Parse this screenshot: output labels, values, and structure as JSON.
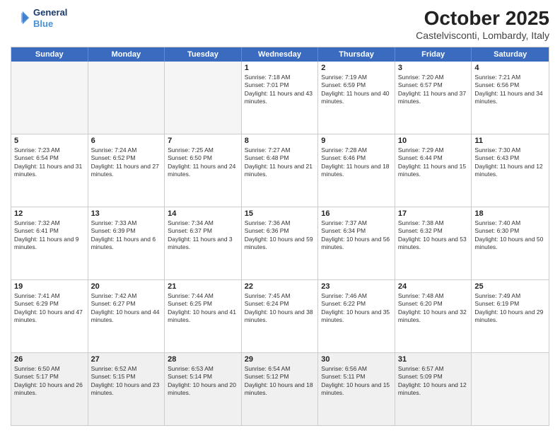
{
  "header": {
    "logo_line1": "General",
    "logo_line2": "Blue",
    "month_title": "October 2025",
    "location": "Castelvisconti, Lombardy, Italy"
  },
  "weekdays": [
    "Sunday",
    "Monday",
    "Tuesday",
    "Wednesday",
    "Thursday",
    "Friday",
    "Saturday"
  ],
  "rows": [
    [
      {
        "day": "",
        "empty": true
      },
      {
        "day": "",
        "empty": true
      },
      {
        "day": "",
        "empty": true
      },
      {
        "day": "1",
        "sunrise": "Sunrise: 7:18 AM",
        "sunset": "Sunset: 7:01 PM",
        "daylight": "Daylight: 11 hours and 43 minutes."
      },
      {
        "day": "2",
        "sunrise": "Sunrise: 7:19 AM",
        "sunset": "Sunset: 6:59 PM",
        "daylight": "Daylight: 11 hours and 40 minutes."
      },
      {
        "day": "3",
        "sunrise": "Sunrise: 7:20 AM",
        "sunset": "Sunset: 6:57 PM",
        "daylight": "Daylight: 11 hours and 37 minutes."
      },
      {
        "day": "4",
        "sunrise": "Sunrise: 7:21 AM",
        "sunset": "Sunset: 6:56 PM",
        "daylight": "Daylight: 11 hours and 34 minutes."
      }
    ],
    [
      {
        "day": "5",
        "sunrise": "Sunrise: 7:23 AM",
        "sunset": "Sunset: 6:54 PM",
        "daylight": "Daylight: 11 hours and 31 minutes."
      },
      {
        "day": "6",
        "sunrise": "Sunrise: 7:24 AM",
        "sunset": "Sunset: 6:52 PM",
        "daylight": "Daylight: 11 hours and 27 minutes."
      },
      {
        "day": "7",
        "sunrise": "Sunrise: 7:25 AM",
        "sunset": "Sunset: 6:50 PM",
        "daylight": "Daylight: 11 hours and 24 minutes."
      },
      {
        "day": "8",
        "sunrise": "Sunrise: 7:27 AM",
        "sunset": "Sunset: 6:48 PM",
        "daylight": "Daylight: 11 hours and 21 minutes."
      },
      {
        "day": "9",
        "sunrise": "Sunrise: 7:28 AM",
        "sunset": "Sunset: 6:46 PM",
        "daylight": "Daylight: 11 hours and 18 minutes."
      },
      {
        "day": "10",
        "sunrise": "Sunrise: 7:29 AM",
        "sunset": "Sunset: 6:44 PM",
        "daylight": "Daylight: 11 hours and 15 minutes."
      },
      {
        "day": "11",
        "sunrise": "Sunrise: 7:30 AM",
        "sunset": "Sunset: 6:43 PM",
        "daylight": "Daylight: 11 hours and 12 minutes."
      }
    ],
    [
      {
        "day": "12",
        "sunrise": "Sunrise: 7:32 AM",
        "sunset": "Sunset: 6:41 PM",
        "daylight": "Daylight: 11 hours and 9 minutes."
      },
      {
        "day": "13",
        "sunrise": "Sunrise: 7:33 AM",
        "sunset": "Sunset: 6:39 PM",
        "daylight": "Daylight: 11 hours and 6 minutes."
      },
      {
        "day": "14",
        "sunrise": "Sunrise: 7:34 AM",
        "sunset": "Sunset: 6:37 PM",
        "daylight": "Daylight: 11 hours and 3 minutes."
      },
      {
        "day": "15",
        "sunrise": "Sunrise: 7:36 AM",
        "sunset": "Sunset: 6:36 PM",
        "daylight": "Daylight: 10 hours and 59 minutes."
      },
      {
        "day": "16",
        "sunrise": "Sunrise: 7:37 AM",
        "sunset": "Sunset: 6:34 PM",
        "daylight": "Daylight: 10 hours and 56 minutes."
      },
      {
        "day": "17",
        "sunrise": "Sunrise: 7:38 AM",
        "sunset": "Sunset: 6:32 PM",
        "daylight": "Daylight: 10 hours and 53 minutes."
      },
      {
        "day": "18",
        "sunrise": "Sunrise: 7:40 AM",
        "sunset": "Sunset: 6:30 PM",
        "daylight": "Daylight: 10 hours and 50 minutes."
      }
    ],
    [
      {
        "day": "19",
        "sunrise": "Sunrise: 7:41 AM",
        "sunset": "Sunset: 6:29 PM",
        "daylight": "Daylight: 10 hours and 47 minutes."
      },
      {
        "day": "20",
        "sunrise": "Sunrise: 7:42 AM",
        "sunset": "Sunset: 6:27 PM",
        "daylight": "Daylight: 10 hours and 44 minutes."
      },
      {
        "day": "21",
        "sunrise": "Sunrise: 7:44 AM",
        "sunset": "Sunset: 6:25 PM",
        "daylight": "Daylight: 10 hours and 41 minutes."
      },
      {
        "day": "22",
        "sunrise": "Sunrise: 7:45 AM",
        "sunset": "Sunset: 6:24 PM",
        "daylight": "Daylight: 10 hours and 38 minutes."
      },
      {
        "day": "23",
        "sunrise": "Sunrise: 7:46 AM",
        "sunset": "Sunset: 6:22 PM",
        "daylight": "Daylight: 10 hours and 35 minutes."
      },
      {
        "day": "24",
        "sunrise": "Sunrise: 7:48 AM",
        "sunset": "Sunset: 6:20 PM",
        "daylight": "Daylight: 10 hours and 32 minutes."
      },
      {
        "day": "25",
        "sunrise": "Sunrise: 7:49 AM",
        "sunset": "Sunset: 6:19 PM",
        "daylight": "Daylight: 10 hours and 29 minutes."
      }
    ],
    [
      {
        "day": "26",
        "sunrise": "Sunrise: 6:50 AM",
        "sunset": "Sunset: 5:17 PM",
        "daylight": "Daylight: 10 hours and 26 minutes."
      },
      {
        "day": "27",
        "sunrise": "Sunrise: 6:52 AM",
        "sunset": "Sunset: 5:15 PM",
        "daylight": "Daylight: 10 hours and 23 minutes."
      },
      {
        "day": "28",
        "sunrise": "Sunrise: 6:53 AM",
        "sunset": "Sunset: 5:14 PM",
        "daylight": "Daylight: 10 hours and 20 minutes."
      },
      {
        "day": "29",
        "sunrise": "Sunrise: 6:54 AM",
        "sunset": "Sunset: 5:12 PM",
        "daylight": "Daylight: 10 hours and 18 minutes."
      },
      {
        "day": "30",
        "sunrise": "Sunrise: 6:56 AM",
        "sunset": "Sunset: 5:11 PM",
        "daylight": "Daylight: 10 hours and 15 minutes."
      },
      {
        "day": "31",
        "sunrise": "Sunrise: 6:57 AM",
        "sunset": "Sunset: 5:09 PM",
        "daylight": "Daylight: 10 hours and 12 minutes."
      },
      {
        "day": "",
        "empty": true
      }
    ]
  ]
}
